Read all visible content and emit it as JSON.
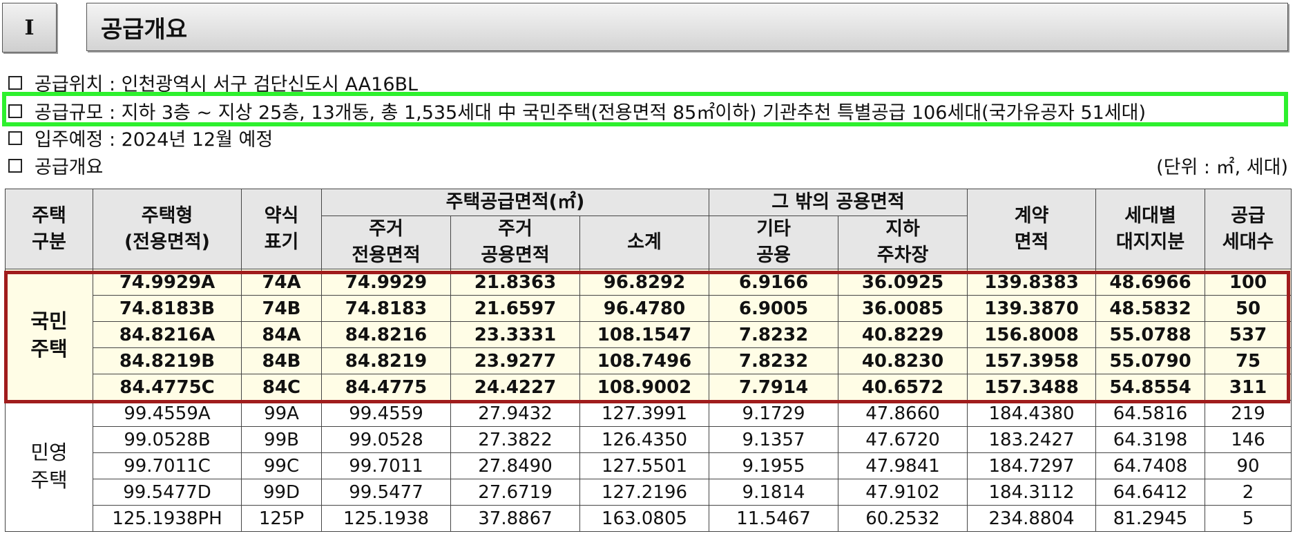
{
  "section": {
    "number": "I",
    "title": "공급개요"
  },
  "info": [
    "공급위치 : 인천광역시 서구 검단신도시 AA16BL",
    "공급규모 : 지하 3층 ~ 지상 25층, 13개동, 총 1,535세대 中 국민주택(전용면적 85㎡이하) 기관추천 특별공급 106세대(국가유공자 51세대)",
    "입주예정 : 2024년 12월 예정",
    "공급개요"
  ],
  "unit_note": "(단위 : ㎡, 세대)",
  "headers": {
    "category": "주택 구분",
    "type": "주택형 (전용면적)",
    "abbr": "약식 표기",
    "supply_area": "주택공급면적(㎡)",
    "exclusive": "주거 전용면적",
    "common": "주거 공용면적",
    "subtotal": "소계",
    "other_common": "그 밖의 공용면적",
    "other": "기타 공용",
    "parking": "지하 주차장",
    "contract": "계약 면적",
    "land": "세대별 대지지분",
    "households": "공급 세대수"
  },
  "groups": [
    {
      "name": "국민 주택",
      "rows": [
        [
          "74.9929A",
          "74A",
          "74.9929",
          "21.8363",
          "96.8292",
          "6.9166",
          "36.0925",
          "139.8383",
          "48.6966",
          "100"
        ],
        [
          "74.8183B",
          "74B",
          "74.8183",
          "21.6597",
          "96.4780",
          "6.9005",
          "36.0085",
          "139.3870",
          "48.5832",
          "50"
        ],
        [
          "84.8216A",
          "84A",
          "84.8216",
          "23.3331",
          "108.1547",
          "7.8232",
          "40.8229",
          "156.8008",
          "55.0788",
          "537"
        ],
        [
          "84.8219B",
          "84B",
          "84.8219",
          "23.9277",
          "108.7496",
          "7.8232",
          "40.8230",
          "157.3958",
          "55.0790",
          "75"
        ],
        [
          "84.4775C",
          "84C",
          "84.4775",
          "24.4227",
          "108.9002",
          "7.7914",
          "40.6572",
          "157.3488",
          "54.8554",
          "311"
        ]
      ]
    },
    {
      "name": "민영 주택",
      "rows": [
        [
          "99.4559A",
          "99A",
          "99.4559",
          "27.9432",
          "127.3991",
          "9.1729",
          "47.8660",
          "184.4380",
          "64.5816",
          "219"
        ],
        [
          "99.0528B",
          "99B",
          "99.0528",
          "27.3822",
          "126.4350",
          "9.1357",
          "47.6720",
          "183.2427",
          "64.3198",
          "146"
        ],
        [
          "99.7011C",
          "99C",
          "99.7011",
          "27.8490",
          "127.5501",
          "9.1955",
          "47.9841",
          "184.7297",
          "64.7408",
          "90"
        ],
        [
          "99.5477D",
          "99D",
          "99.5477",
          "27.6719",
          "127.2196",
          "9.1814",
          "47.9102",
          "184.3112",
          "64.6412",
          "2"
        ],
        [
          "125.1938PH",
          "125P",
          "125.1938",
          "37.8867",
          "163.0805",
          "11.5467",
          "60.2532",
          "234.8804",
          "81.2945",
          "5"
        ]
      ]
    }
  ],
  "colors": {
    "highlight_green": "#2ef02e",
    "highlight_red": "#a01c1c",
    "public_row_bg": "#fffde6"
  }
}
